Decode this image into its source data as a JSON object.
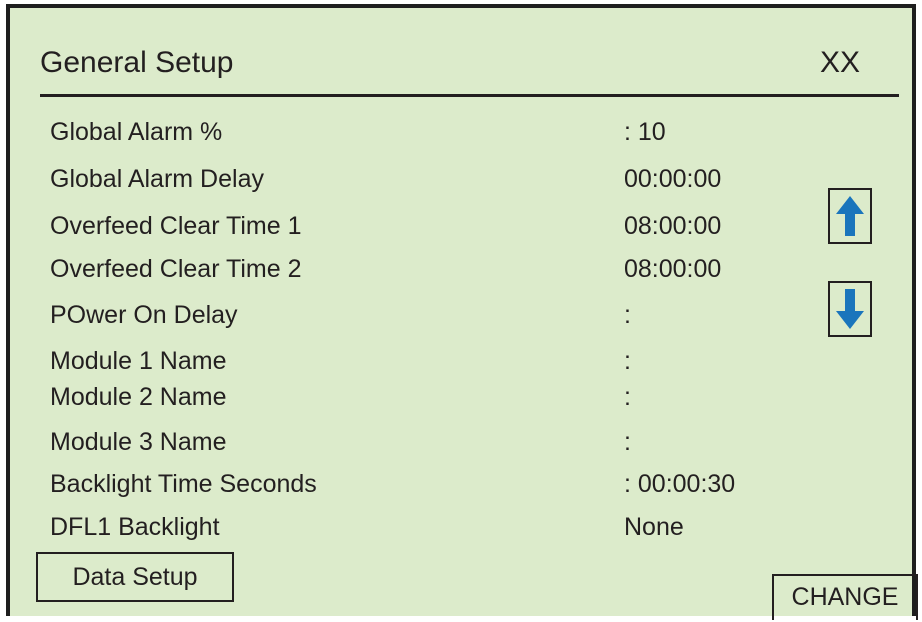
{
  "header": {
    "title": "General Setup",
    "code": "XX"
  },
  "settings": [
    {
      "label": "Global Alarm %",
      "value": ": 10"
    },
    {
      "label": "Global Alarm Delay",
      "value": "00:00:00"
    },
    {
      "label": "Overfeed Clear Time 1",
      "value": "08:00:00"
    },
    {
      "label": "Overfeed Clear Time 2",
      "value": "08:00:00"
    },
    {
      "label": "POwer On Delay",
      "value": ":"
    },
    {
      "label": "Module 1 Name",
      "value": ":"
    },
    {
      "label": "Module 2 Name",
      "value": ":"
    },
    {
      "label": "Module 3 Name",
      "value": ":"
    },
    {
      "label": "Backlight Time Seconds",
      "value": ": 00:00:30"
    },
    {
      "label": "DFL1 Backlight",
      "value": "None"
    }
  ],
  "buttons": {
    "data_setup": "Data Setup",
    "change": "CHANGE"
  },
  "icons": {
    "scroll_up": "arrow-up-icon",
    "scroll_down": "arrow-down-icon"
  },
  "colors": {
    "screen_background": "#dcebcb",
    "text": "#231f20",
    "arrow": "#1a75bc"
  }
}
